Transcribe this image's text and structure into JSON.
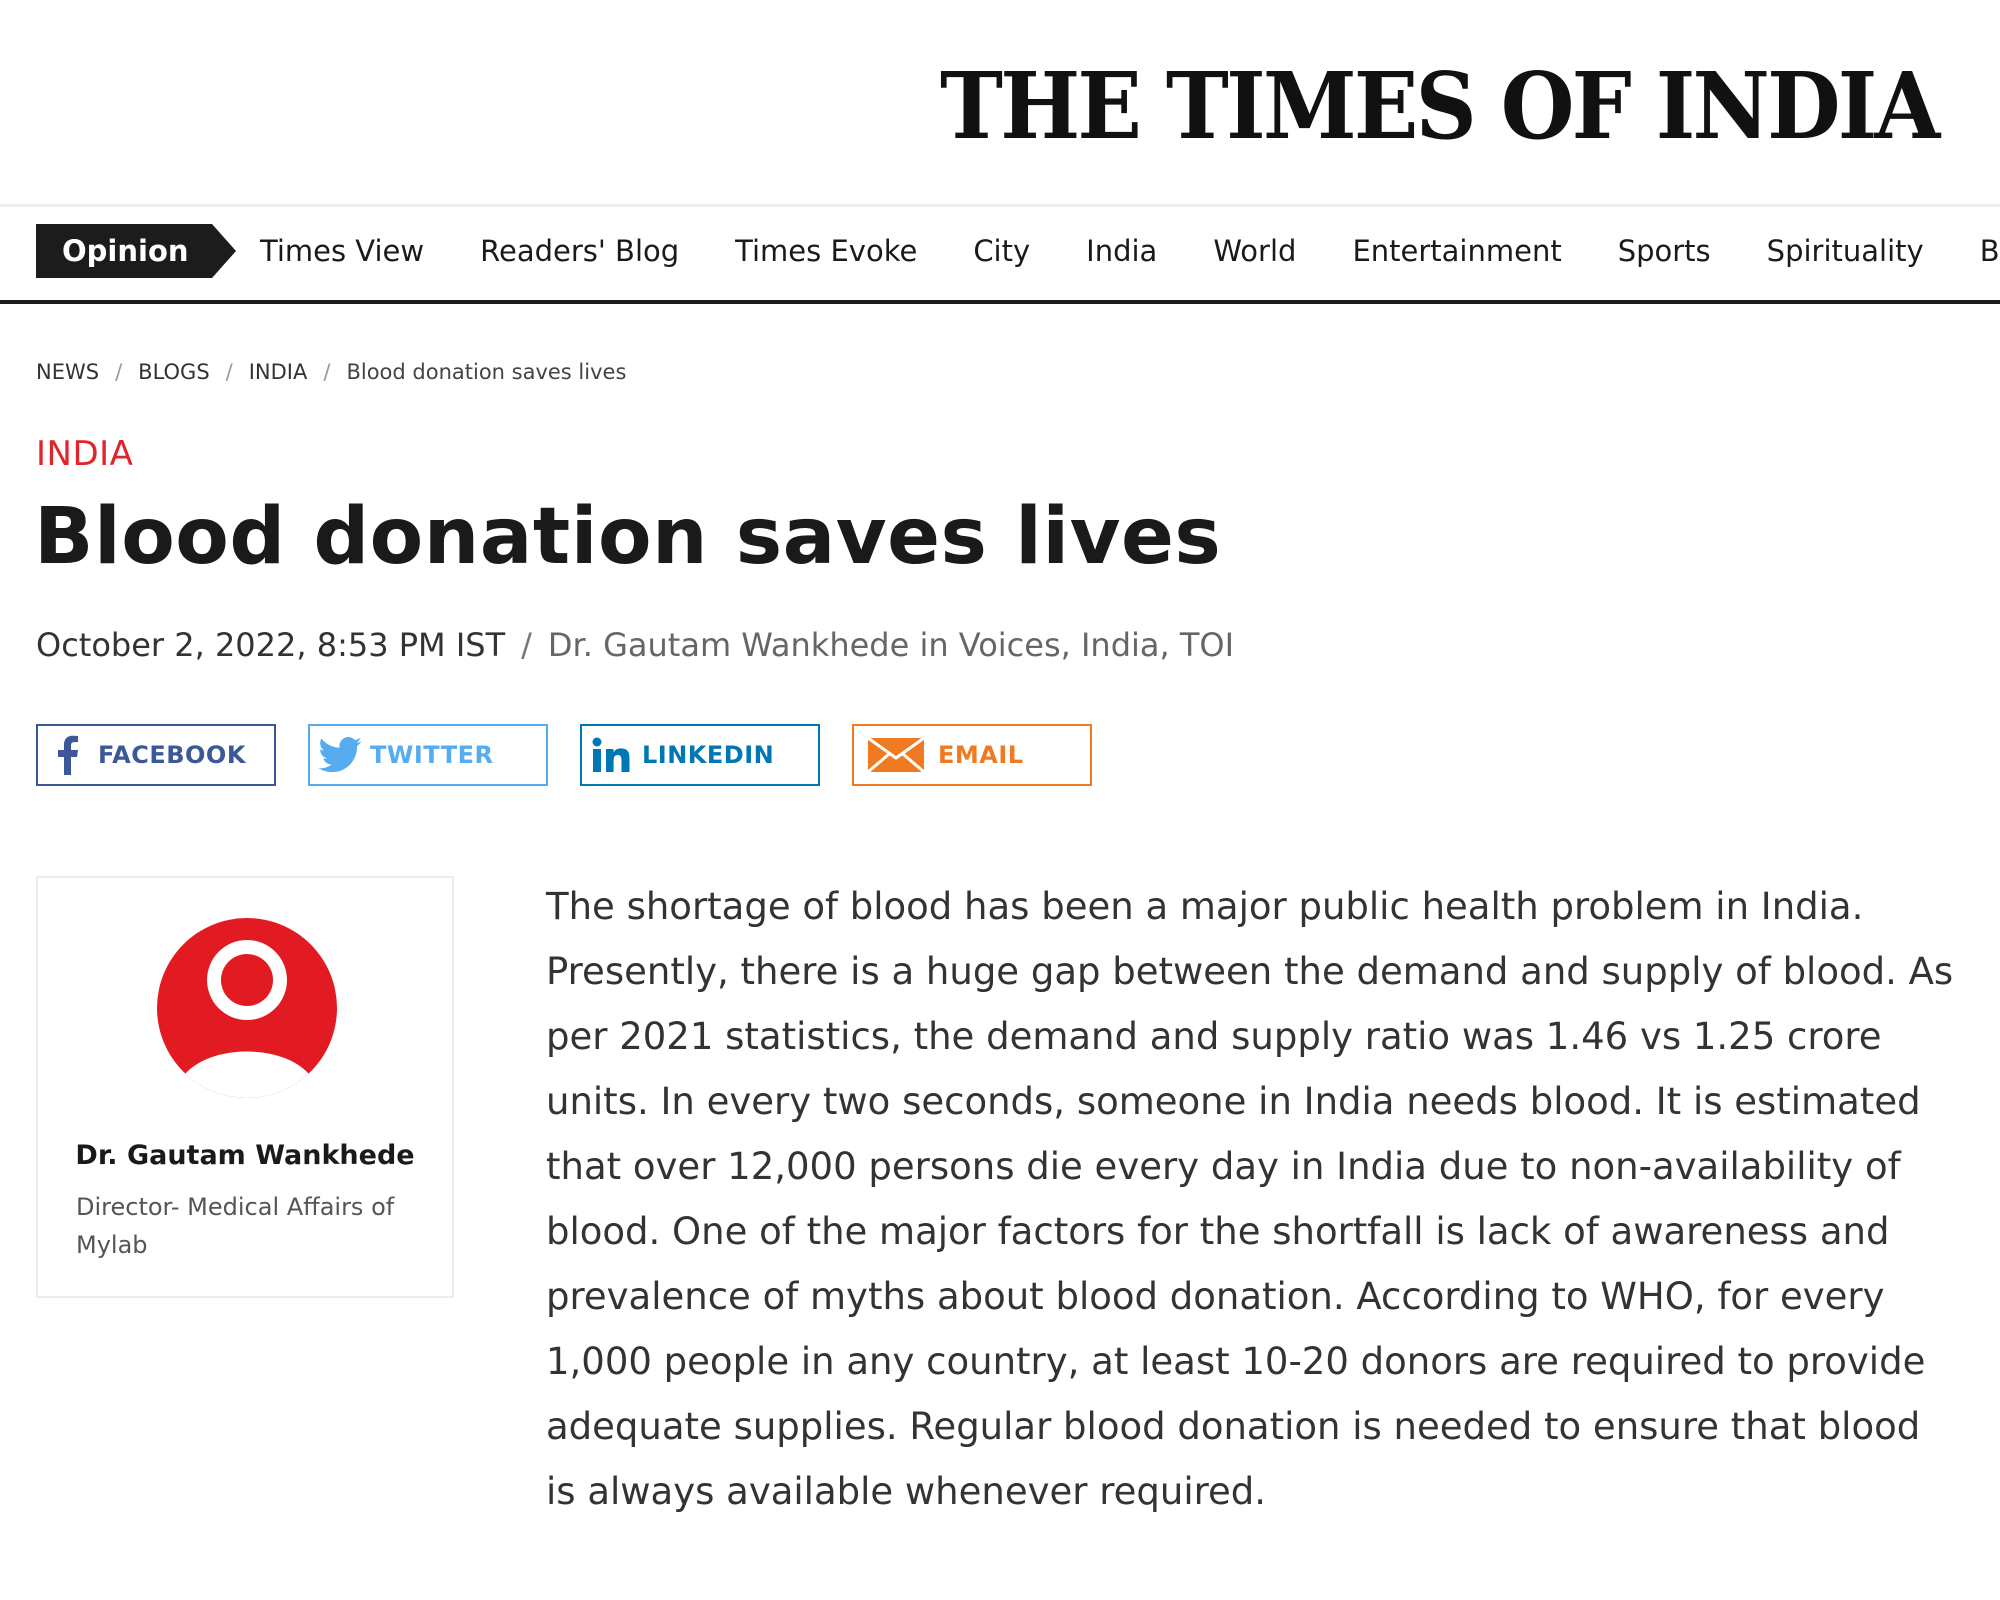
{
  "masthead": {
    "title": "THE TIMES OF INDIA"
  },
  "nav": {
    "active": "Opinion",
    "items": [
      "Times View",
      "Readers' Blog",
      "Times Evoke",
      "City",
      "India",
      "World",
      "Entertainment",
      "Sports",
      "Spirituality",
      "Busin"
    ]
  },
  "breadcrumb": {
    "items": [
      "NEWS",
      "BLOGS",
      "INDIA"
    ],
    "current": "Blood donation saves lives",
    "separator": "/"
  },
  "article": {
    "category": "INDIA",
    "title": "Blood donation saves lives",
    "date": "October 2, 2022, 8:53 PM IST",
    "meta_separator": "/",
    "byline": "Dr. Gautam Wankhede in Voices, India, TOI",
    "body": "The shortage of blood has been a major public health problem in India. Presently, there is a huge gap between the demand and supply of blood. As per 2021 statistics, the demand and supply ratio was 1.46 vs 1.25 crore units. In every two seconds, someone in India needs blood. It is estimated that over 12,000 persons die every day in India due to non-availability of blood. One of the major factors for the shortfall is lack of awareness and prevalence of myths about blood donation. According to WHO, for every 1,000 people in any country, at least 10-20 donors are required to provide adequate supplies. Regular blood donation is needed to ensure that blood is always available whenever required."
  },
  "share": {
    "facebook": {
      "label": "FACEBOOK",
      "icon": "facebook-icon",
      "color": "#3b5998"
    },
    "twitter": {
      "label": "TWITTER",
      "icon": "twitter-icon",
      "color": "#55acee"
    },
    "linkedin": {
      "label": "LINKEDIN",
      "icon": "linkedin-icon",
      "color": "#0077b5"
    },
    "email": {
      "label": "EMAIL",
      "icon": "email-icon",
      "color": "#f07a22"
    }
  },
  "author": {
    "name": "Dr. Gautam Wankhede",
    "role": "Director- Medical Affairs of Mylab",
    "avatar_icon": "user-avatar-icon",
    "avatar_color": "#e21b23"
  },
  "colors": {
    "category": "#e0242a",
    "nav_active_bg": "#1c1c1c"
  }
}
